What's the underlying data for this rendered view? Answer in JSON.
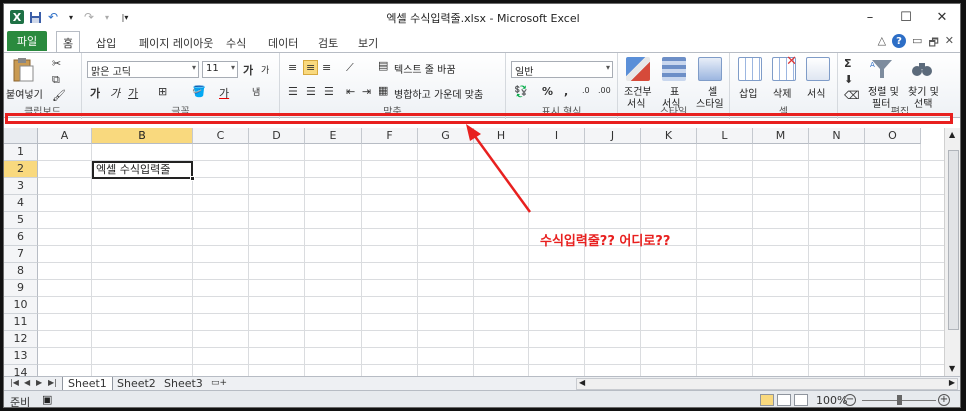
{
  "window": {
    "title": "엑셀 수식입력줄.xlsx - Microsoft Excel",
    "minimize": "–",
    "maximize": "☐",
    "close": "✕"
  },
  "qat": {
    "logo": "X",
    "save": "💾",
    "undo": "↶",
    "redo": "↷",
    "more": "▾"
  },
  "tabs": [
    "홈",
    "삽입",
    "페이지 레이아웃",
    "수식",
    "데이터",
    "검토",
    "보기"
  ],
  "file_tab": "파일",
  "ribbon": {
    "clipboard": {
      "paste": "붙여넣기",
      "label": "클립보드"
    },
    "font": {
      "name": "맑은 고딕",
      "size": "11",
      "grow": "가",
      "shrink": "가",
      "bold": "가",
      "italic": "가",
      "underline": "가",
      "color_a": "가",
      "phonetic": "냄",
      "label": "글꼴"
    },
    "alignment": {
      "wrap": "텍스트 줄 바꿈",
      "merge": "병합하고 가운데 맞춤",
      "label": "맞춤"
    },
    "number": {
      "format": "일반",
      "percent": "%",
      "comma": ",",
      "label": "표시 형식"
    },
    "styles": {
      "conditional_1": "조건부",
      "conditional_2": "서식",
      "table_1": "표",
      "table_2": "서식",
      "cell_1": "셀",
      "cell_2": "스타일",
      "label": "스타일"
    },
    "cells": {
      "insert": "삽입",
      "delete": "삭제",
      "format": "서식",
      "label": "셀"
    },
    "editing": {
      "sort_1": "정렬 및",
      "sort_2": "필터",
      "find_1": "찾기 및",
      "find_2": "선택",
      "sigma": "Σ",
      "label": "편집"
    }
  },
  "grid": {
    "columns": [
      "A",
      "B",
      "C",
      "D",
      "E",
      "F",
      "G",
      "H",
      "I",
      "J",
      "K",
      "L",
      "M",
      "N",
      "O"
    ],
    "rows": [
      "1",
      "2",
      "3",
      "4",
      "5",
      "6",
      "7",
      "8",
      "9",
      "10",
      "11",
      "12",
      "13",
      "14"
    ],
    "selected_column": "B",
    "selected_row": "2",
    "cell_b2": "엑셀 수식입력줄"
  },
  "annotation": {
    "text": "수식입력줄?? 어디로??",
    "color": "#e8201f"
  },
  "sheets": [
    "Sheet1",
    "Sheet2",
    "Sheet3"
  ],
  "active_sheet": "Sheet1",
  "statusbar": {
    "ready": "준비",
    "zoom": "100%",
    "zoom_out": "−",
    "zoom_in": "+"
  },
  "colors": {
    "excel_green": "#2a8a3e",
    "selection": "#f9d97e",
    "highlight": "#e8201f"
  }
}
